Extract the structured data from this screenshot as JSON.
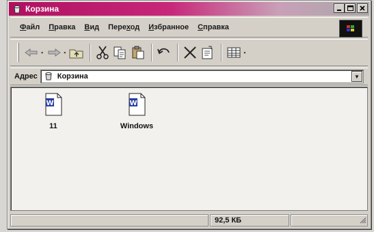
{
  "window": {
    "title": "Корзина"
  },
  "menu": [
    {
      "label": "Файл",
      "accel": "Ф",
      "rest": "айл"
    },
    {
      "label": "Правка",
      "accel": "П",
      "rest": "равка"
    },
    {
      "label": "Вид",
      "accel": "В",
      "rest": "ид"
    },
    {
      "label": "Переход",
      "pre": "Пере",
      "accel": "х",
      "rest": "од"
    },
    {
      "label": "Избранное",
      "accel": "И",
      "rest": "збранное"
    },
    {
      "label": "Справка",
      "accel": "С",
      "rest": "правка"
    }
  ],
  "toolbar": {
    "icons": [
      "back-arrow-icon",
      "forward-arrow-icon",
      "up-folder-icon",
      "cut-icon",
      "copy-icon",
      "paste-icon",
      "undo-icon",
      "delete-icon",
      "properties-icon",
      "views-icon"
    ]
  },
  "address": {
    "label": "Адрес",
    "value": "Корзина"
  },
  "files": [
    {
      "name": "11",
      "icon": "word-document-icon"
    },
    {
      "name": "Windows",
      "icon": "word-document-icon"
    }
  ],
  "status": {
    "size": "92,5 КБ"
  },
  "colors": {
    "titlebar_start": "#b01060",
    "window_face": "#d4d0c8",
    "content_bg": "#f3f1ee"
  }
}
